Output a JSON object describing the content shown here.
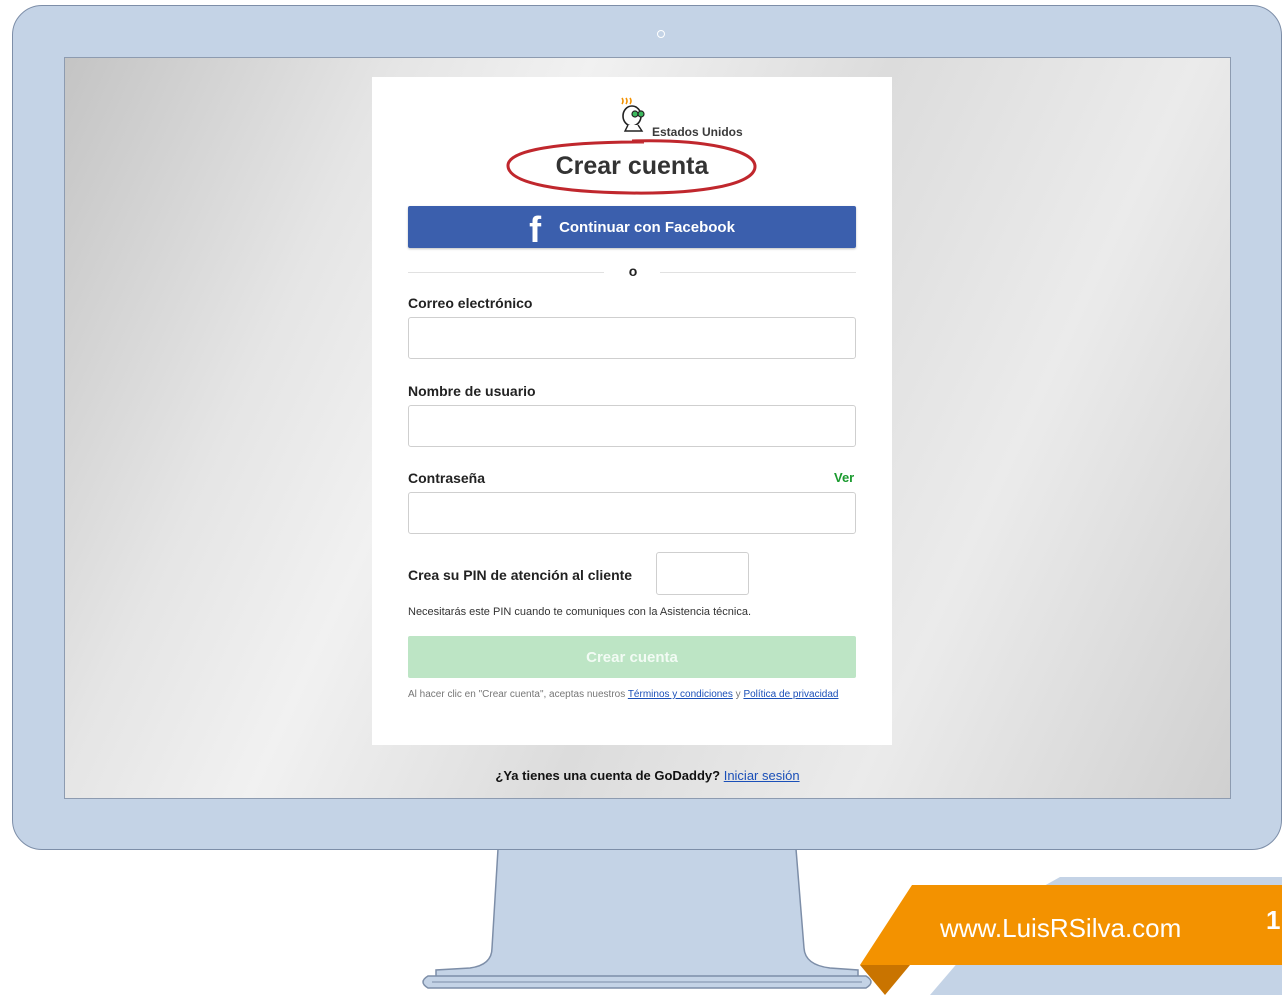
{
  "signup": {
    "country": "Estados Unidos",
    "title": "Crear cuenta",
    "facebook_icon": "f",
    "facebook_button": "Continuar con Facebook",
    "divider_text": "o",
    "email_label": "Correo electrónico",
    "username_label": "Nombre de usuario",
    "password_label": "Contraseña",
    "show_password": "Ver",
    "pin_label": "Crea su PIN de atención al cliente",
    "pin_help": "Necesitarás este PIN cuando te comuniques con la Asistencia técnica.",
    "create_button": "Crear cuenta",
    "terms_prefix": "Al hacer clic en \"Crear cuenta\", aceptas nuestros",
    "terms_link": "Términos y condiciones",
    "terms_and": "y",
    "privacy_link": "Política de privacidad",
    "login_prompt": "¿Ya tienes una cuenta de GoDaddy?",
    "login_link": "Iniciar sesión"
  },
  "banner": {
    "website": "www.LuisRSilva.com",
    "page_number": "1"
  },
  "colors": {
    "facebook_blue": "#3b5fad",
    "disabled_green": "#bde5c5",
    "show_link_green": "#1a9a2e",
    "annotation_red": "#c0272d",
    "banner_orange": "#f39200",
    "monitor_blue": "#c4d3e6"
  },
  "icons": [
    "facebook-icon",
    "godaddy-logo-icon",
    "camera-icon"
  ]
}
